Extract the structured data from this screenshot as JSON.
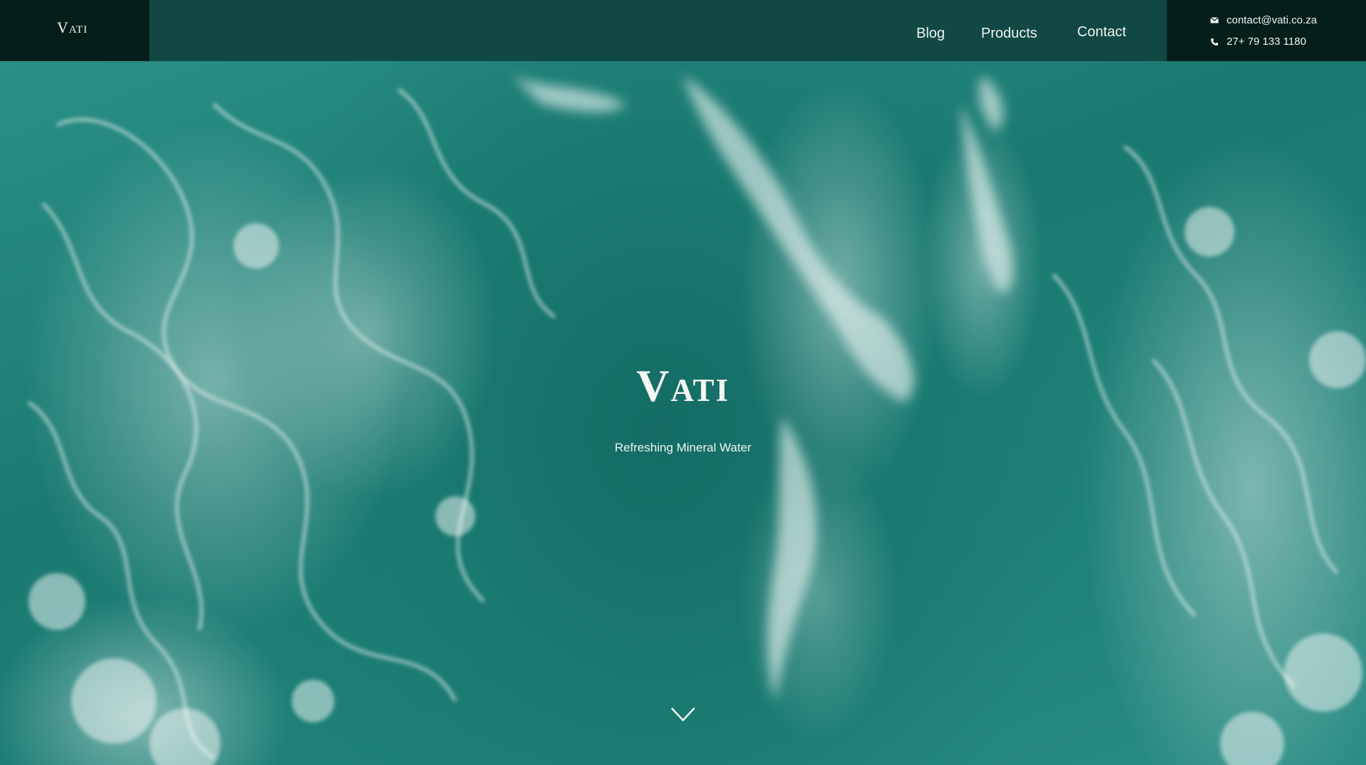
{
  "header": {
    "logo": "Vati",
    "nav": [
      {
        "label": "Blog"
      },
      {
        "label": "Products"
      },
      {
        "label": "Contact"
      }
    ],
    "contact": {
      "email": "contact@vati.co.za",
      "phone": "27+ 79 133 1180",
      "email_icon": "mail-icon",
      "phone_icon": "phone-icon"
    }
  },
  "hero": {
    "title": "Vati",
    "subtitle": "Refreshing Mineral Water",
    "scroll_icon": "chevron-down-icon"
  },
  "colors": {
    "header_bg": "#124843",
    "logo_bg": "#061e1b",
    "contact_bg": "#061e1b",
    "ocean": "#1b7a70",
    "text": "#f2f2ee"
  }
}
